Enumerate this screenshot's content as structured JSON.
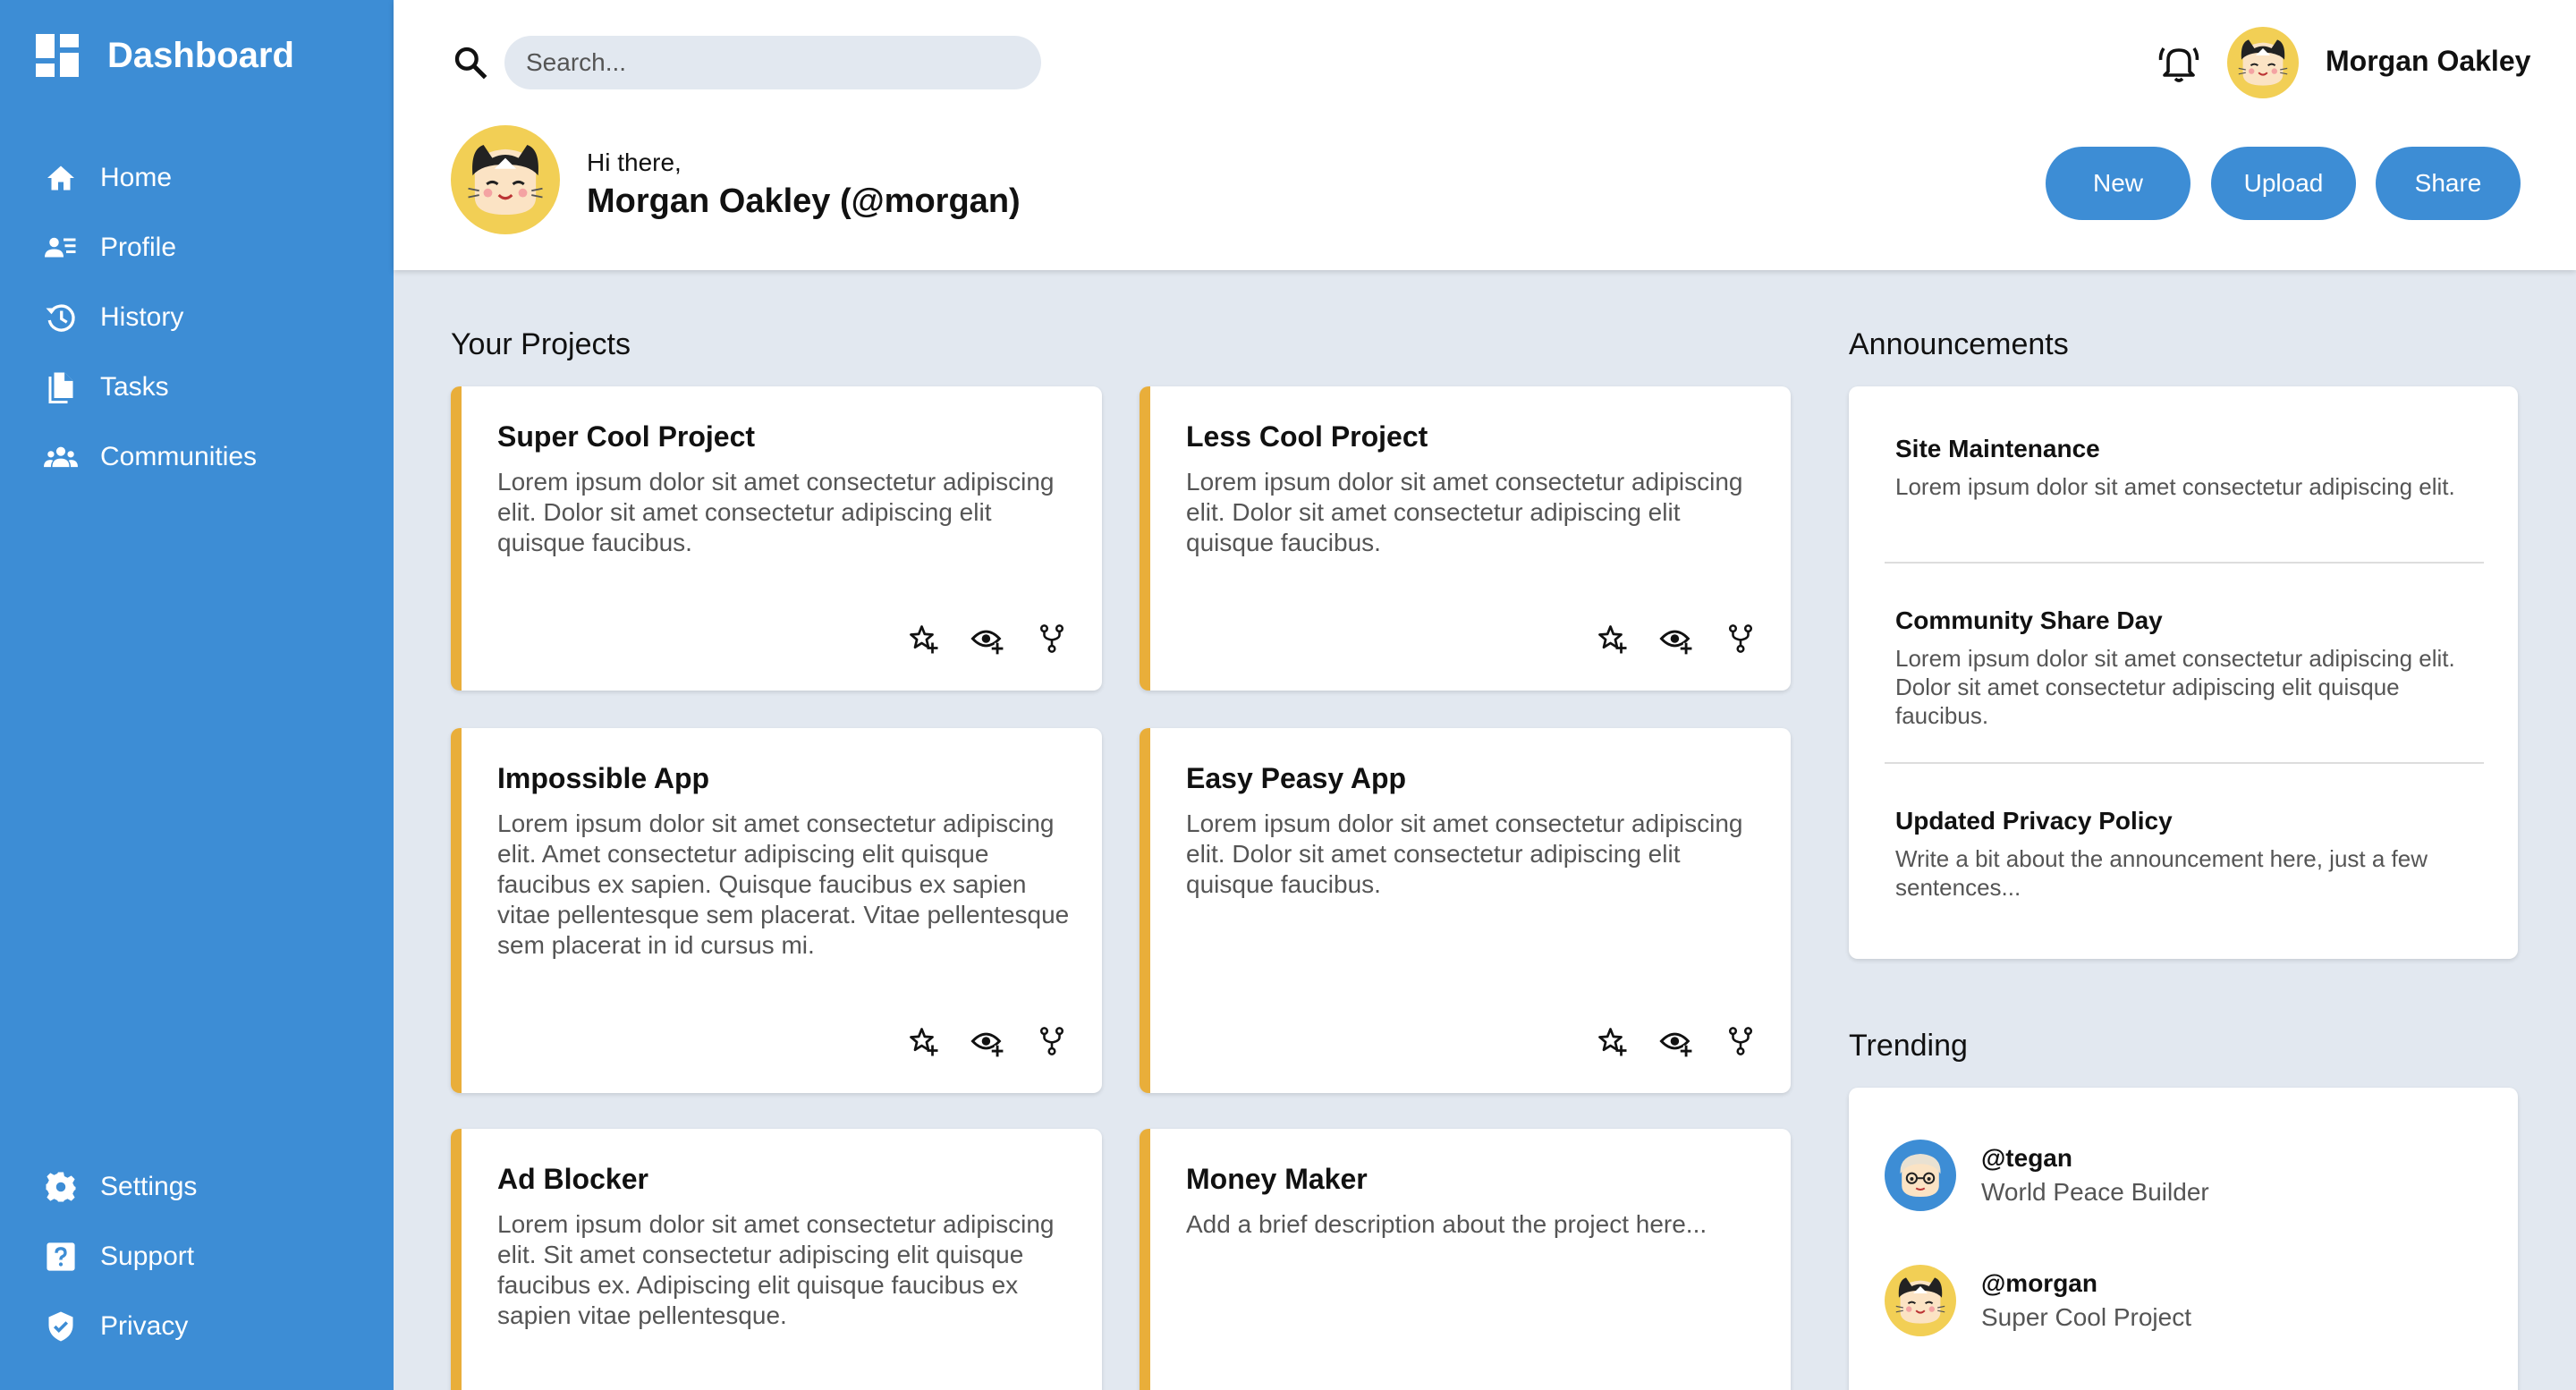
{
  "sidebar": {
    "brand": "Dashboard",
    "nav": [
      {
        "label": "Home",
        "icon": "home-icon"
      },
      {
        "label": "Profile",
        "icon": "profile-icon"
      },
      {
        "label": "History",
        "icon": "history-icon"
      },
      {
        "label": "Tasks",
        "icon": "tasks-icon"
      },
      {
        "label": "Communities",
        "icon": "communities-icon"
      }
    ],
    "bottom_nav": [
      {
        "label": "Settings",
        "icon": "gear-icon"
      },
      {
        "label": "Support",
        "icon": "help-icon"
      },
      {
        "label": "Privacy",
        "icon": "shield-icon"
      }
    ]
  },
  "header": {
    "search_placeholder": "Search...",
    "user_name": "Morgan Oakley",
    "greeting": "Hi there,",
    "greeting_name": "Morgan Oakley (@morgan)",
    "buttons": {
      "new": "New",
      "upload": "Upload",
      "share": "Share"
    }
  },
  "projects": {
    "title": "Your Projects",
    "items": [
      {
        "title": "Super Cool Project",
        "desc": "Lorem ipsum dolor sit amet consectetur adipiscing elit. Dolor sit amet consectetur adipiscing elit quisque faucibus."
      },
      {
        "title": "Less Cool Project",
        "desc": "Lorem ipsum dolor sit amet consectetur adipiscing elit. Dolor sit amet consectetur adipiscing elit quisque faucibus."
      },
      {
        "title": "Impossible App",
        "desc": "Lorem ipsum dolor sit amet consectetur adipiscing elit. Amet consectetur adipiscing elit quisque faucibus ex sapien. Quisque faucibus ex sapien vitae pellentesque sem placerat. Vitae pellentesque sem placerat in id cursus mi."
      },
      {
        "title": "Easy Peasy App",
        "desc": "Lorem ipsum dolor sit amet consectetur adipiscing elit. Dolor sit amet consectetur adipiscing elit quisque faucibus."
      },
      {
        "title": "Ad Blocker",
        "desc": "Lorem ipsum dolor sit amet consectetur adipiscing elit. Sit amet consectetur adipiscing elit quisque faucibus ex. Adipiscing elit quisque faucibus ex sapien vitae pellentesque."
      },
      {
        "title": "Money Maker",
        "desc": "Add a brief description about the project here..."
      }
    ]
  },
  "announcements": {
    "title": "Announcements",
    "items": [
      {
        "title": "Site Maintenance",
        "text": "Lorem ipsum dolor sit amet consectetur adipiscing elit."
      },
      {
        "title": "Community Share Day",
        "text": "Lorem ipsum dolor sit amet consectetur adipiscing elit. Dolor sit amet consectetur adipiscing elit quisque faucibus."
      },
      {
        "title": "Updated Privacy Policy",
        "text": "Write a bit about the announcement here, just a few sentences..."
      }
    ]
  },
  "trending": {
    "title": "Trending",
    "items": [
      {
        "handle": "@tegan",
        "sub": "World Peace Builder"
      },
      {
        "handle": "@morgan",
        "sub": "Super Cool Project"
      }
    ]
  },
  "colors": {
    "sidebar": "#3d8dd5",
    "accent": "#e9ae3a",
    "background": "#e2e8f0"
  }
}
